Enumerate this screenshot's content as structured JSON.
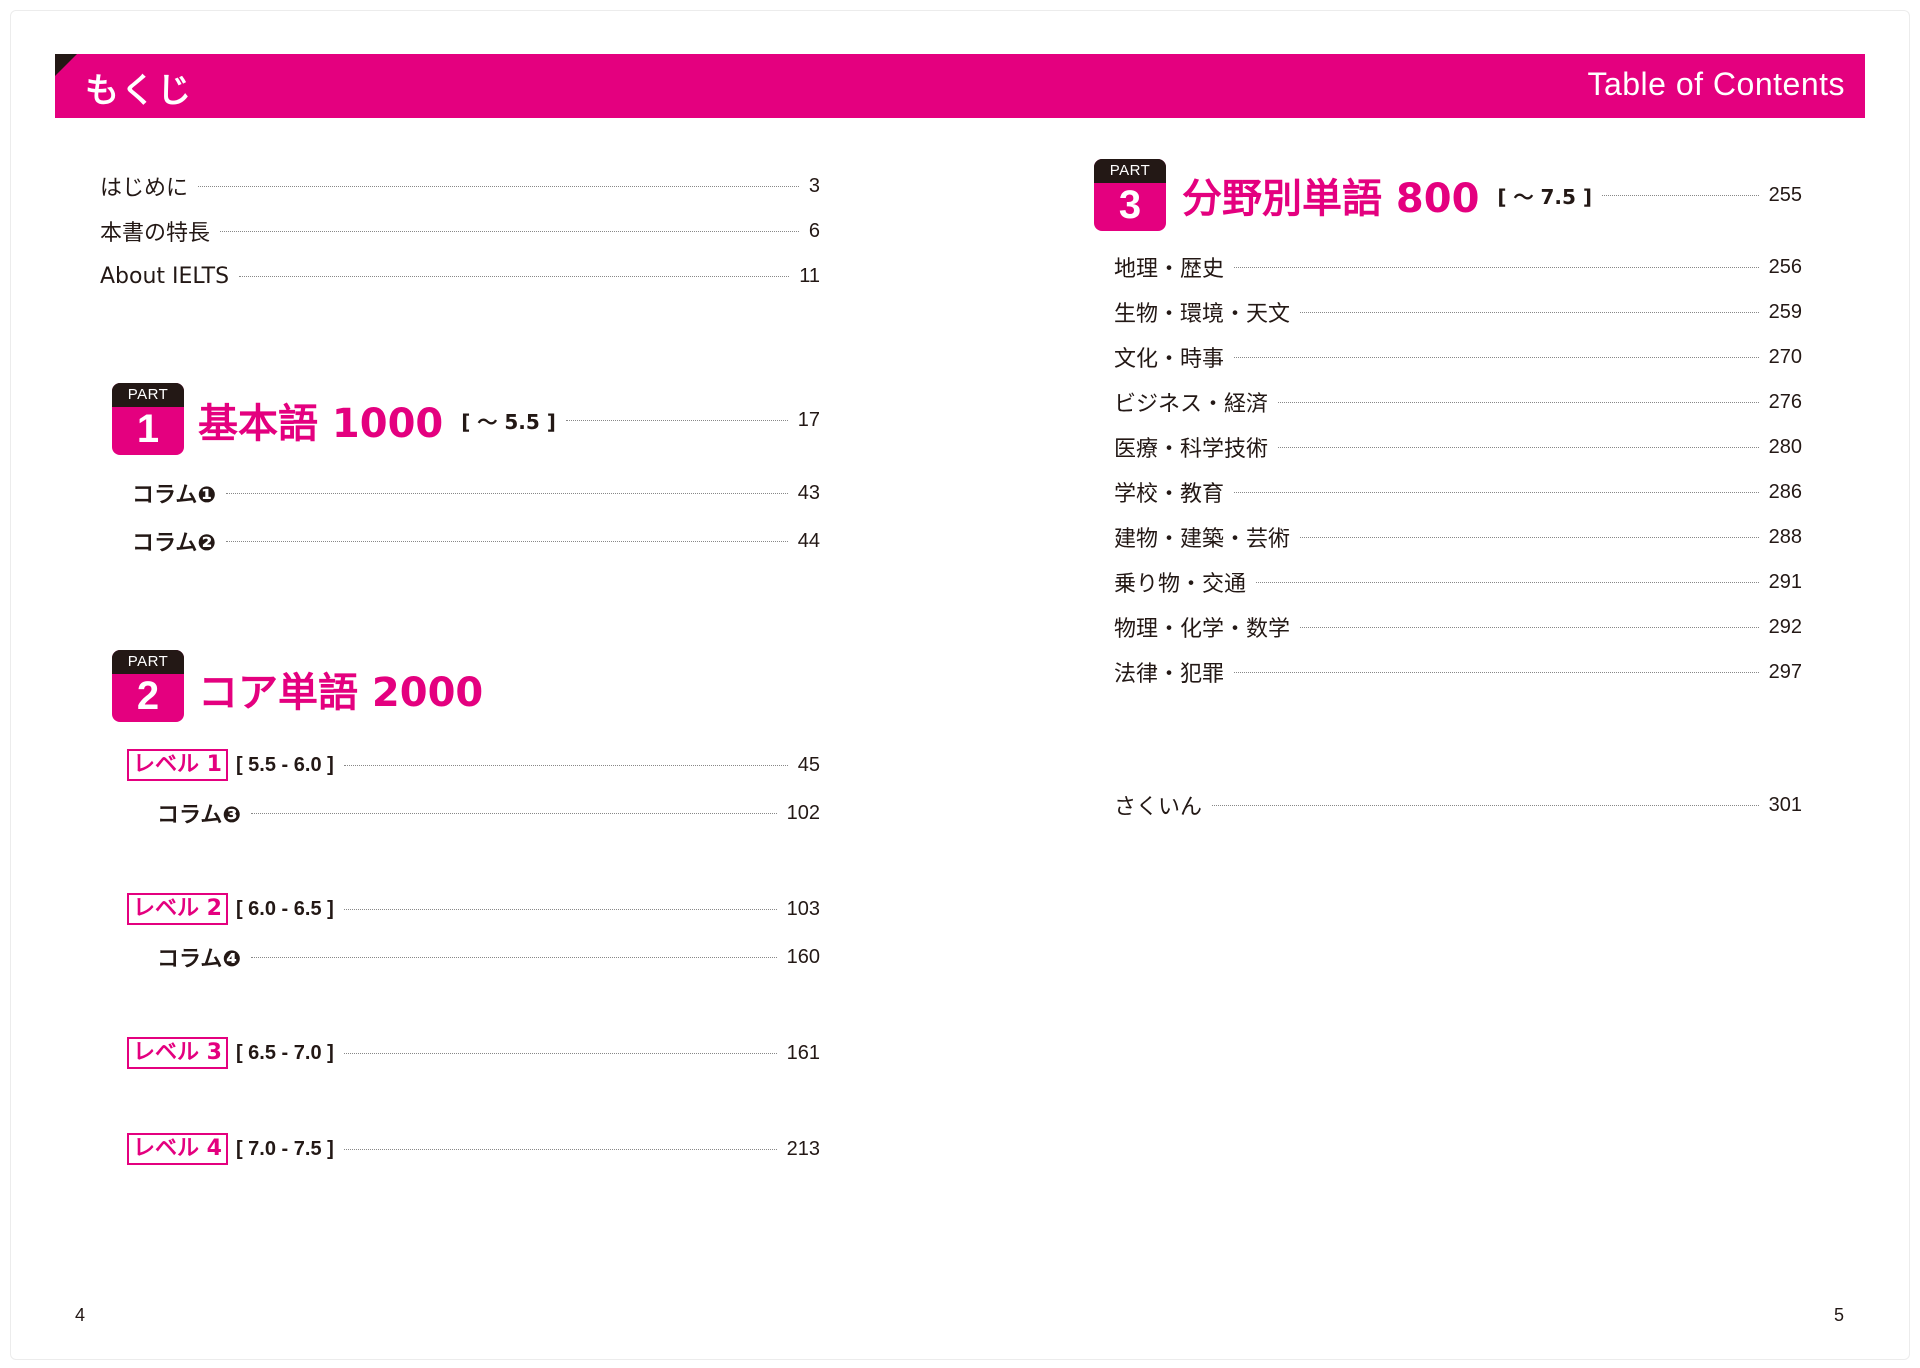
{
  "header": {
    "title_jp": "もくじ",
    "title_en": "Table of Contents"
  },
  "left": {
    "intro": [
      {
        "label": "はじめに",
        "page": "3"
      },
      {
        "label": "本書の特長",
        "page": "6"
      },
      {
        "label": "About IELTS",
        "page": "11"
      }
    ],
    "part1": {
      "badge_label": "PART",
      "badge_num": "1",
      "title": "基本語 1000",
      "range": "[ ～ 5.5 ]",
      "page": "17",
      "columns": [
        {
          "label": "コラム❶",
          "page": "43"
        },
        {
          "label": "コラム❷",
          "page": "44"
        }
      ]
    },
    "part2": {
      "badge_label": "PART",
      "badge_num": "2",
      "title": "コア単語 2000",
      "levels": [
        {
          "label": "レベル 1",
          "range": "[ 5.5 - 6.0 ]",
          "page": "45",
          "column": {
            "label": "コラム❸",
            "page": "102"
          }
        },
        {
          "label": "レベル 2",
          "range": "[ 6.0 - 6.5 ]",
          "page": "103",
          "column": {
            "label": "コラム❹",
            "page": "160"
          }
        },
        {
          "label": "レベル 3",
          "range": "[ 6.5 - 7.0 ]",
          "page": "161"
        },
        {
          "label": "レベル 4",
          "range": "[ 7.0 - 7.5 ]",
          "page": "213"
        }
      ]
    },
    "page_number": "4"
  },
  "right": {
    "part3": {
      "badge_label": "PART",
      "badge_num": "3",
      "title": "分野別単語 800",
      "range": "[ ～ 7.5 ]",
      "page": "255",
      "items": [
        {
          "label": "地理・歴史",
          "page": "256"
        },
        {
          "label": "生物・環境・天文",
          "page": "259"
        },
        {
          "label": "文化・時事",
          "page": "270"
        },
        {
          "label": "ビジネス・経済",
          "page": "276"
        },
        {
          "label": "医療・科学技術",
          "page": "280"
        },
        {
          "label": "学校・教育",
          "page": "286"
        },
        {
          "label": "建物・建築・芸術",
          "page": "288"
        },
        {
          "label": "乗り物・交通",
          "page": "291"
        },
        {
          "label": "物理・化学・数学",
          "page": "292"
        },
        {
          "label": "法律・犯罪",
          "page": "297"
        }
      ]
    },
    "index": {
      "label": "さくいん",
      "page": "301"
    },
    "page_number": "5"
  }
}
